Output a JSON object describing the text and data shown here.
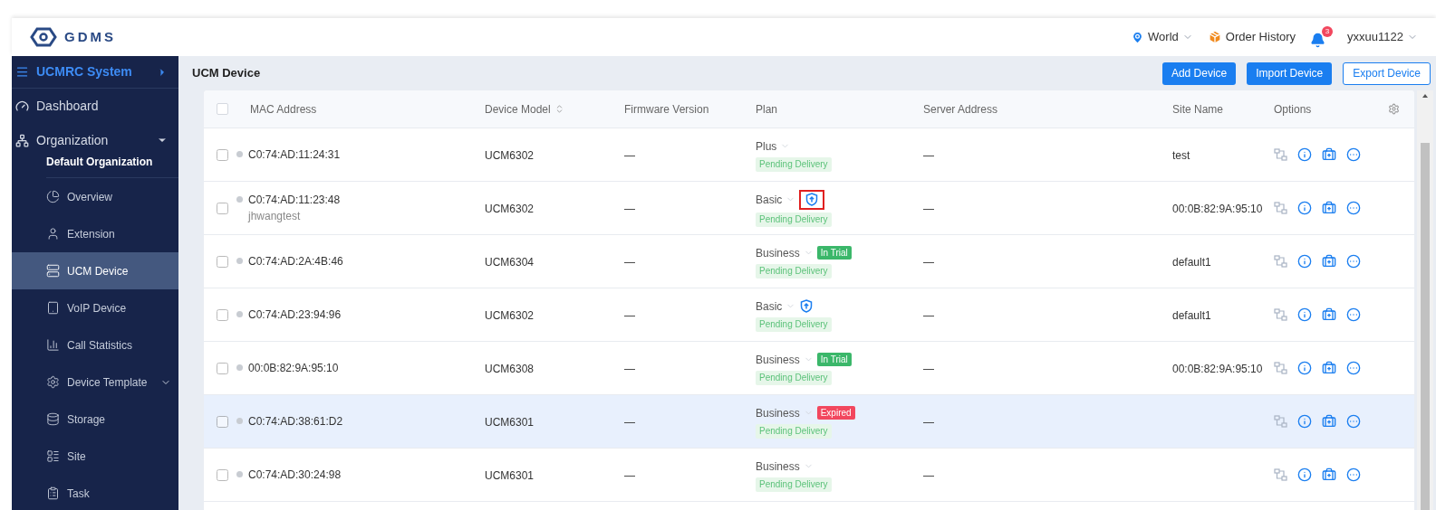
{
  "header": {
    "logo_text": "GDMS",
    "region": "World",
    "order_history": "Order History",
    "notification_count": "3",
    "user": "yxxuu1122"
  },
  "sidebar": {
    "system": "UCMRC System",
    "items": [
      {
        "label": "Dashboard",
        "selected": false
      },
      {
        "label": "Organization",
        "selected": false,
        "expanded": true,
        "organization": "Default Organization",
        "children": [
          {
            "label": "Overview",
            "selected": false
          },
          {
            "label": "Extension",
            "selected": false
          },
          {
            "label": "UCM Device",
            "selected": true
          },
          {
            "label": "VoIP Device",
            "selected": false
          },
          {
            "label": "Call Statistics",
            "selected": false
          },
          {
            "label": "Device Template",
            "selected": false,
            "expanded": false
          },
          {
            "label": "Storage",
            "selected": false
          },
          {
            "label": "Site",
            "selected": false
          },
          {
            "label": "Task",
            "selected": false
          }
        ]
      }
    ]
  },
  "page": {
    "title": "UCM Device",
    "buttons": [
      {
        "label": "Add Device",
        "kind": "primary"
      },
      {
        "label": "Import Device",
        "kind": "primary"
      },
      {
        "label": "Export Device",
        "kind": "outline"
      }
    ]
  },
  "table": {
    "all_checked": false,
    "columns": [
      "MAC Address",
      "Device Model",
      "Firmware Version",
      "Plan",
      "Server Address",
      "Site Name",
      "Options"
    ],
    "rows": [
      {
        "checked": false,
        "selected": false,
        "mac": "C0:74:AD:11:24:31",
        "model": "UCM6302",
        "firmware": "—",
        "plan": "Plus",
        "status": "Pending Delivery",
        "server": "—",
        "site": "test"
      },
      {
        "checked": false,
        "selected": false,
        "mac": "C0:74:AD:11:23:48",
        "name": "jhwangtest",
        "model": "UCM6302",
        "firmware": "—",
        "plan": "Basic",
        "upgrade": true,
        "highlighted": true,
        "status": "Pending Delivery",
        "server": "—",
        "site": "00:0B:82:9A:95:10"
      },
      {
        "checked": false,
        "selected": false,
        "mac": "C0:74:AD:2A:4B:46",
        "model": "UCM6304",
        "firmware": "—",
        "plan": "Business",
        "badge": {
          "label": "In Trial",
          "color": "#3bb76a"
        },
        "status": "Pending Delivery",
        "server": "—",
        "site": "default1"
      },
      {
        "checked": false,
        "selected": false,
        "mac": "C0:74:AD:23:94:96",
        "model": "UCM6302",
        "firmware": "—",
        "plan": "Basic",
        "upgrade": true,
        "status": "Pending Delivery",
        "server": "—",
        "site": "default1"
      },
      {
        "checked": false,
        "selected": false,
        "mac": "00:0B:82:9A:95:10",
        "model": "UCM6308",
        "firmware": "—",
        "plan": "Business",
        "badge": {
          "label": "In Trial",
          "color": "#3bb76a"
        },
        "status": "Pending Delivery",
        "server": "—",
        "site": "00:0B:82:9A:95:10"
      },
      {
        "checked": false,
        "selected": true,
        "mac": "C0:74:AD:38:61:D2",
        "model": "UCM6301",
        "firmware": "—",
        "plan": "Business",
        "badge": {
          "label": "Expired",
          "color": "#f2475e"
        },
        "status": "Pending Delivery",
        "server": "—"
      },
      {
        "checked": false,
        "selected": false,
        "mac": "C0:74:AD:30:24:98",
        "model": "UCM6301",
        "firmware": "—",
        "plan": "Business",
        "status": "Pending Delivery",
        "server": "—"
      }
    ]
  }
}
